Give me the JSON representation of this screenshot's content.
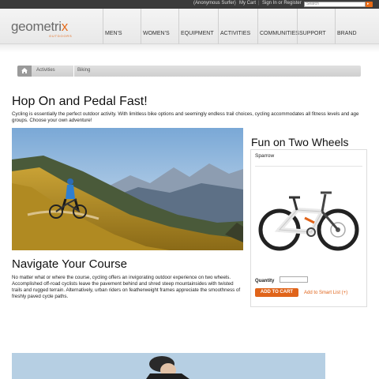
{
  "topbar": {
    "user": "(Anonymous Surfer)",
    "cart": "My Cart",
    "signin": "Sign In or Register",
    "search_placeholder": "Search"
  },
  "logo": {
    "word_main": "geometri",
    "word_x": "x",
    "sub": "OUTDOORS"
  },
  "nav": [
    "MEN'S",
    "WOMEN'S",
    "EQUIPMENT",
    "ACTIVITIES",
    "COMMUNITIES",
    "SUPPORT",
    "BRAND"
  ],
  "breadcrumb": [
    "Activities",
    "Biking"
  ],
  "page": {
    "title": "Hop On and Pedal Fast!",
    "intro": "Cycling is essentially the perfect outdoor activity. With limitless bike options and seemingly endless trail choices, cycling accommodates all fitness levels and age groups. Choose your own adventure!",
    "section_title": "Navigate Your Course",
    "section_text": "No matter what or where the course, cycling offers an invigorating outdoor experience on two wheels. Accomplished off-road cyclists leave the pavement behind and shred steep mountainsides with twisted trails and rugged terrain. Alternatively, urban riders on featherweight frames appreciate the smoothness of freshly paved cycle paths."
  },
  "side": {
    "title": "Fun on Two Wheels",
    "product_name": "Sparrow",
    "quantity_label": "Quantity",
    "add_to_cart": "ADD TO CART",
    "smart_list": "Add to Smart List (+)"
  },
  "colors": {
    "accent": "#e0641a",
    "topbar": "#3b3b3b"
  }
}
